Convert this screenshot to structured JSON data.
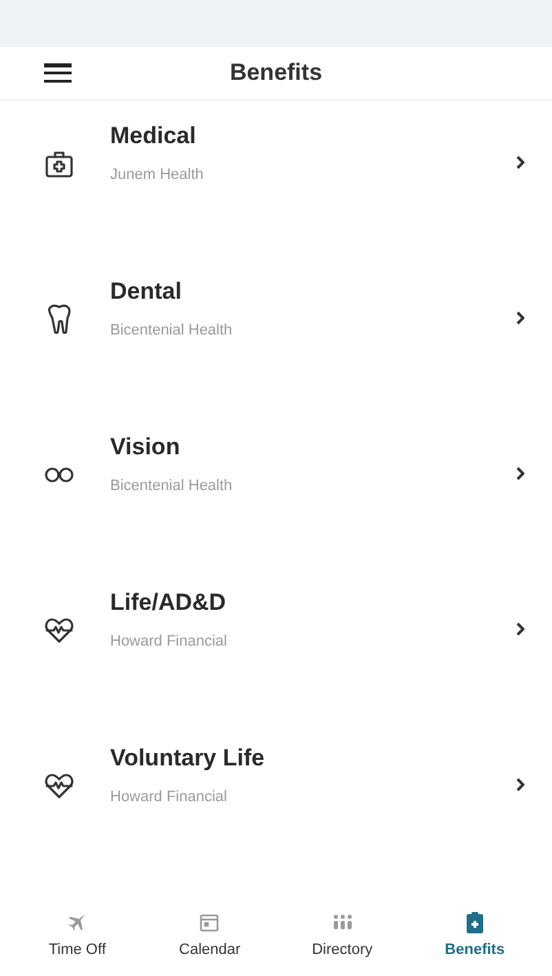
{
  "header": {
    "title": "Benefits"
  },
  "benefits": [
    {
      "kind": "medical",
      "title": "Medical",
      "provider": "Junem Health"
    },
    {
      "kind": "dental",
      "title": "Dental",
      "provider": "Bicentenial Health"
    },
    {
      "kind": "vision",
      "title": "Vision",
      "provider": "Bicentenial Health"
    },
    {
      "kind": "life",
      "title": "Life/AD&D",
      "provider": "Howard Financial"
    },
    {
      "kind": "life",
      "title": "Voluntary Life",
      "provider": "Howard Financial"
    }
  ],
  "tabs": [
    {
      "kind": "plane",
      "label": "Time Off",
      "selected": false
    },
    {
      "kind": "calendar",
      "label": "Calendar",
      "selected": false
    },
    {
      "kind": "people",
      "label": "Directory",
      "selected": false
    },
    {
      "kind": "clipboard",
      "label": "Benefits",
      "selected": true
    }
  ]
}
